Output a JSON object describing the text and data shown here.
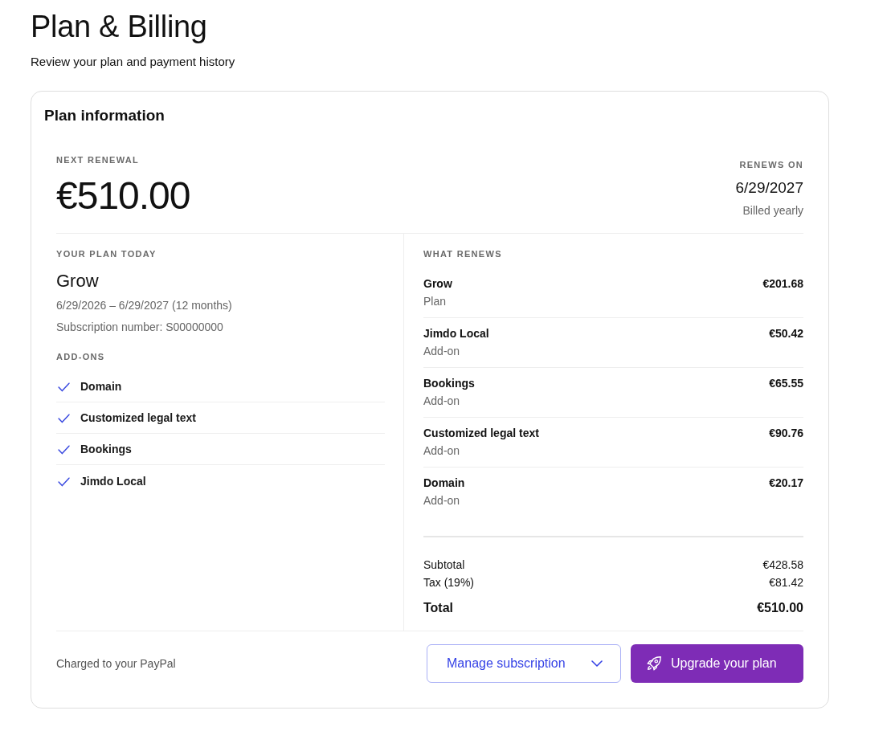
{
  "page": {
    "title": "Plan & Billing",
    "subtitle": "Review your plan and payment history"
  },
  "plan_card": {
    "title": "Plan information",
    "next_renewal": {
      "label": "NEXT RENEWAL",
      "amount": "€510.00"
    },
    "renews_on": {
      "label": "RENEWS ON",
      "date": "6/29/2027",
      "billing": "Billed yearly"
    },
    "current_plan": {
      "label": "YOUR PLAN TODAY",
      "name": "Grow",
      "period": "6/29/2026 – 6/29/2027 (12 months)",
      "subscription": "Subscription number: S00000000",
      "addons_label": "ADD-ONS",
      "addons": [
        {
          "name": "Domain",
          "checked": true
        },
        {
          "name": "Customized legal text",
          "checked": true
        },
        {
          "name": "Bookings",
          "checked": true
        },
        {
          "name": "Jimdo Local",
          "checked": true
        }
      ]
    },
    "what_renews": {
      "label": "WHAT RENEWS",
      "items": [
        {
          "name": "Grow",
          "type": "Plan",
          "price": "€201.68"
        },
        {
          "name": "Jimdo Local",
          "type": "Add-on",
          "price": "€50.42"
        },
        {
          "name": "Bookings",
          "type": "Add-on",
          "price": "€65.55"
        },
        {
          "name": "Customized legal text",
          "type": "Add-on",
          "price": "€90.76"
        },
        {
          "name": "Domain",
          "type": "Add-on",
          "price": "€20.17"
        }
      ],
      "totals": [
        {
          "kind": "subtotal",
          "label": "Subtotal",
          "amount": "€428.58"
        },
        {
          "kind": "tax",
          "label": "Tax (19%)",
          "amount": "€81.42"
        },
        {
          "kind": "total",
          "label": "Total",
          "amount": "€510.00"
        }
      ]
    },
    "footer": {
      "payment_note": "Charged to your PayPal",
      "buttons": [
        {
          "kind": "secondary",
          "label": "Manage subscription"
        },
        {
          "kind": "primary",
          "label": "Upgrade your plan"
        }
      ]
    }
  }
}
